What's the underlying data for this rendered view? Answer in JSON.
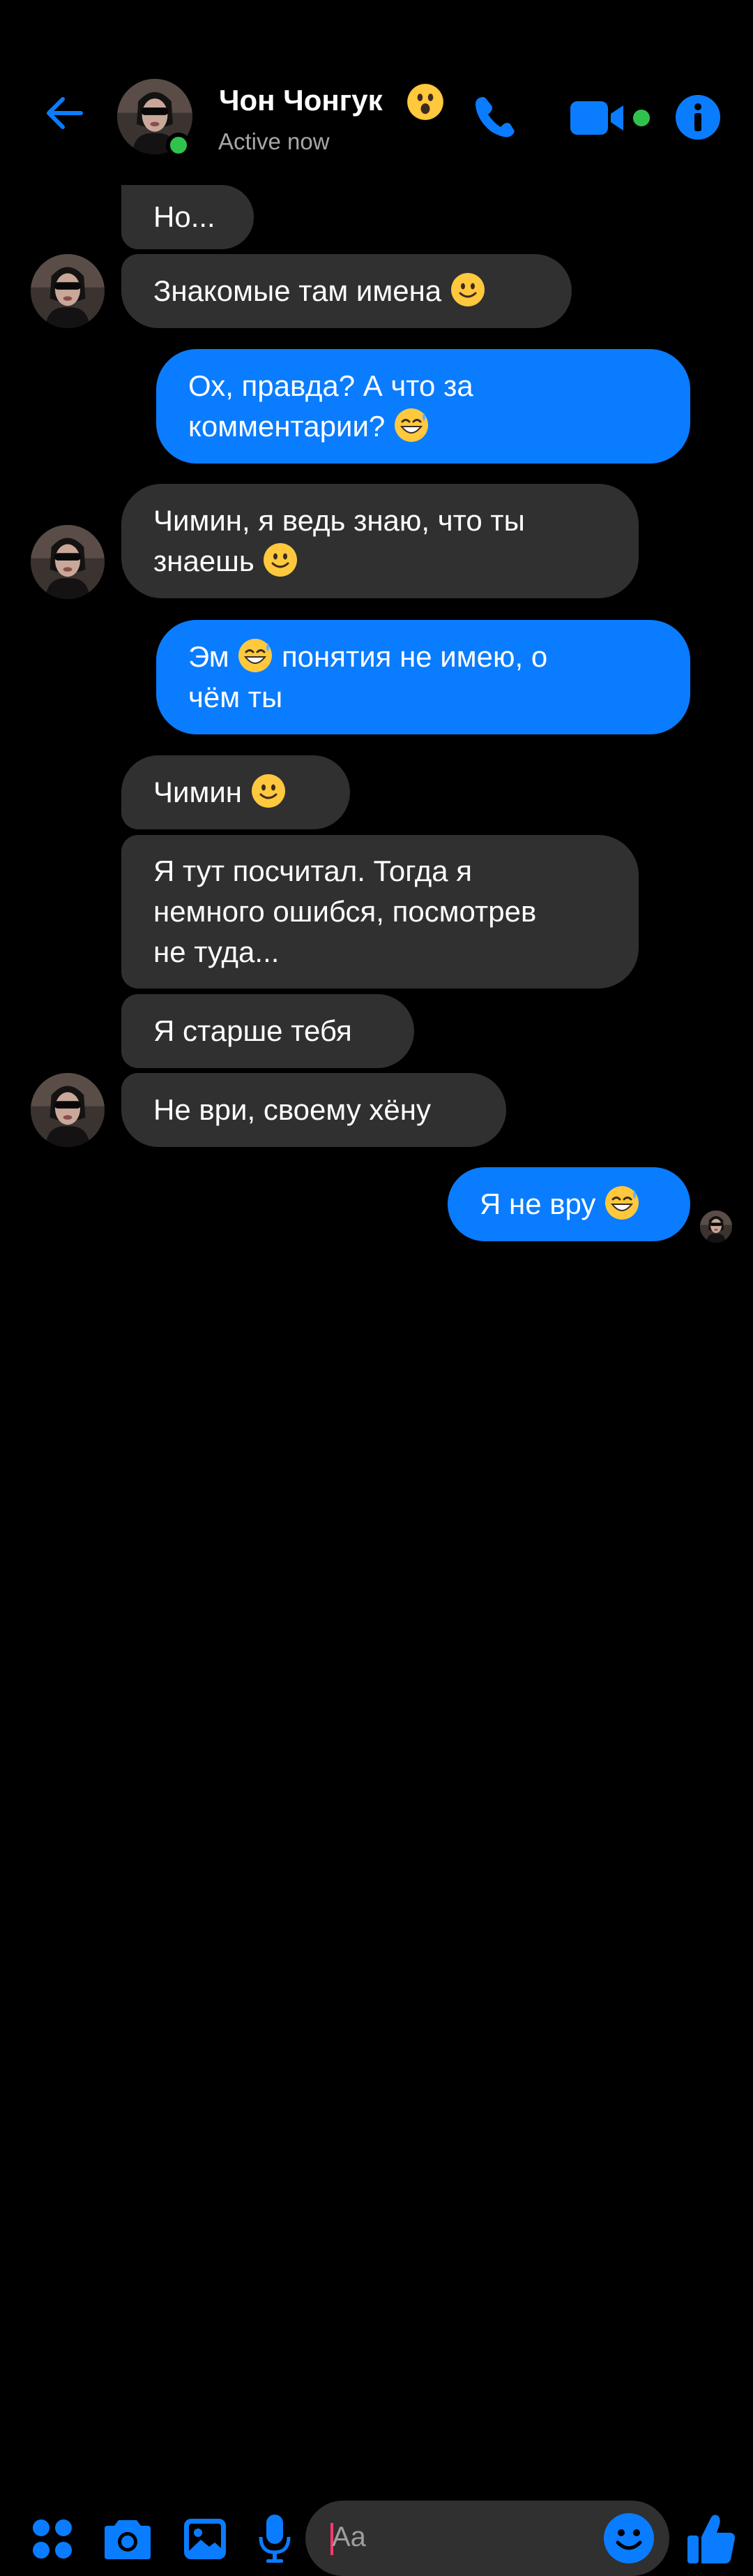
{
  "header": {
    "contact_name": "Чон Чонгук",
    "name_emoji": "astonished-face",
    "status": "Active now",
    "icons": [
      "back-arrow-icon",
      "phone-icon",
      "video-camera-icon",
      "info-icon"
    ],
    "accent_color": "#0a7cff",
    "online_color": "#31c24d"
  },
  "messages": [
    {
      "side": "in",
      "text": "Но..."
    },
    {
      "side": "in",
      "text": "Знакомые там имена",
      "emoji": "slightly-smiling-face"
    },
    {
      "side": "out",
      "text": "Ох, правда? А что за\nкомментарии?",
      "emoji": "sweat-smile-face"
    },
    {
      "side": "in",
      "text": "Чимин, я ведь знаю, что ты\nзнаешь",
      "emoji": "slightly-smiling-face"
    },
    {
      "side": "out",
      "text_before": "Эм",
      "emoji": "sweat-smile-face",
      "text_after": "понятия не имею, о\nчём ты"
    },
    {
      "side": "in",
      "text": "Чимин",
      "emoji": "slightly-smiling-face"
    },
    {
      "side": "in",
      "text": "Я тут посчитал. Тогда я\nнемного ошибся, посмотрев\nне туда..."
    },
    {
      "side": "in",
      "text": "Я старше тебя"
    },
    {
      "side": "in",
      "text": "Не ври, своему хёну"
    },
    {
      "side": "out",
      "text": "Я не вру",
      "emoji": "sweat-smile-face"
    }
  ],
  "composer": {
    "placeholder": "Aa",
    "icons": [
      "apps-icon",
      "camera-icon",
      "gallery-icon",
      "microphone-icon",
      "emoji-icon",
      "thumbs-up-icon"
    ]
  },
  "colors": {
    "background": "#000000",
    "incoming_bubble": "#303030",
    "outgoing_bubble": "#0a7cff",
    "emoji_yellow": "#ffc83d"
  }
}
